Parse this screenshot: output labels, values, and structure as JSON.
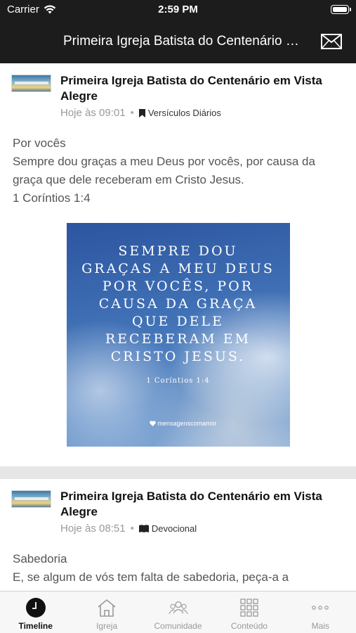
{
  "status_bar": {
    "carrier": "Carrier",
    "time": "2:59 PM"
  },
  "nav": {
    "title": "Primeira Igreja Batista do Centenário em Vista Alegre",
    "mail_icon": "mail-icon"
  },
  "posts": [
    {
      "author": "Primeira Igreja Batista do Centenário em Vista Alegre",
      "time": "Hoje às 09:01",
      "category": "Versículos Diários",
      "category_icon": "bookmark-icon",
      "heading": "Por vocês",
      "text": "Sempre dou graças a meu Deus por vocês, por causa da graça que dele receberam em Cristo Jesus.",
      "reference": "1 Coríntios 1:4",
      "image": {
        "verse_text": "Sempre dou graças a meu Deus por vocês, por causa da graça que dele receberam em Cristo Jesus.",
        "verse_ref": "1 Coríntios 1:4",
        "brand": "mensagenscomamor"
      }
    },
    {
      "author": "Primeira Igreja Batista do Centenário em Vista Alegre",
      "time": "Hoje às 08:51",
      "category": "Devocional",
      "category_icon": "book-icon",
      "heading": "Sabedoria",
      "text": "E, se algum de vós tem falta de sabedoria, peça-a a"
    }
  ],
  "tab_bar": {
    "tabs": [
      {
        "label": "Timeline",
        "icon": "clock-icon",
        "active": true
      },
      {
        "label": "Igreja",
        "icon": "church-icon",
        "active": false
      },
      {
        "label": "Comunidade",
        "icon": "people-icon",
        "active": false
      },
      {
        "label": "Conteúdo",
        "icon": "grid-icon",
        "active": false
      },
      {
        "label": "Mais",
        "icon": "more-icon",
        "active": false
      }
    ]
  },
  "colors": {
    "bar_background": "#1c1c1c",
    "active_tab": "#111111",
    "inactive_tab": "#999999",
    "divider": "#e6e6e6"
  }
}
